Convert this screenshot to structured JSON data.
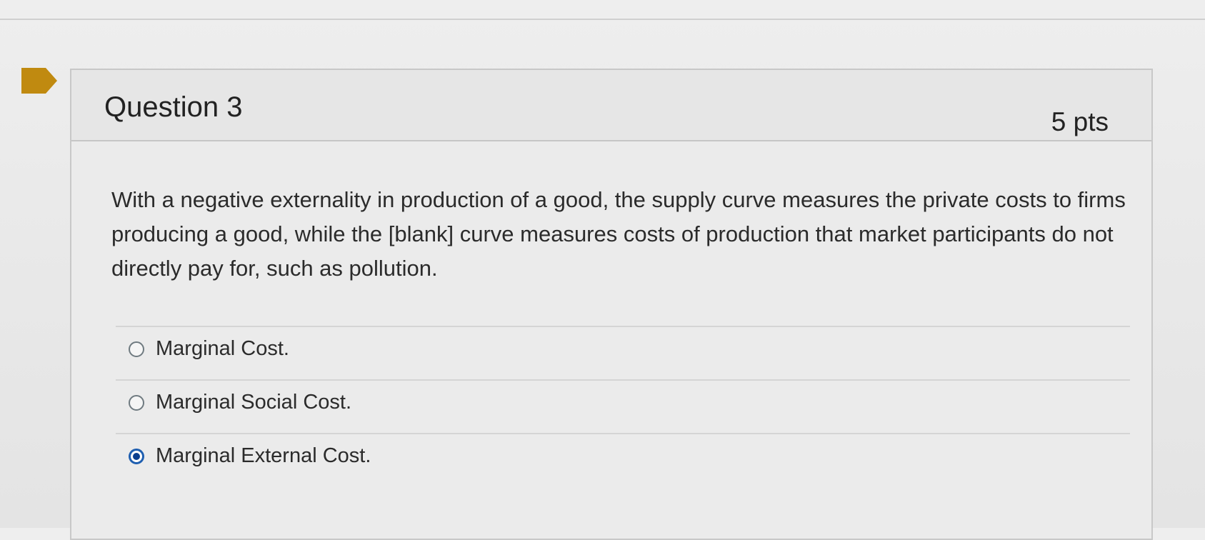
{
  "question": {
    "title": "Question 3",
    "points": "5 pts",
    "text": "With a negative externality in production of a good, the supply curve measures the private costs to firms producing a good, while the [blank] curve measures costs of production that market participants do not directly pay for, such as pollution.",
    "flag_color": "#c08a10"
  },
  "answers": [
    {
      "label": "Marginal Cost.",
      "selected": false
    },
    {
      "label": "Marginal Social Cost.",
      "selected": false
    },
    {
      "label": "Marginal External Cost.",
      "selected": true
    }
  ],
  "colors": {
    "selected_radio": "#1f5fb0"
  }
}
